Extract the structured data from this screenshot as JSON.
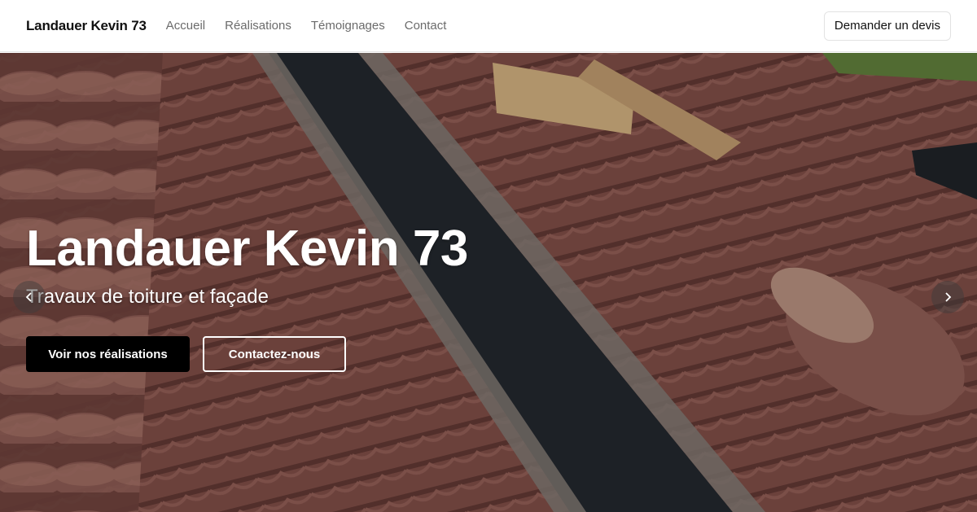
{
  "header": {
    "brand": "Landauer Kevin 73",
    "nav": [
      "Accueil",
      "Réalisations",
      "Témoignages",
      "Contact"
    ],
    "cta": "Demander un devis"
  },
  "hero": {
    "title": "Landauer Kevin 73",
    "subtitle": "Travaux de toiture et façade",
    "primary_button": "Voir nos réalisations",
    "secondary_button": "Contactez-nous",
    "prev_icon": "chevron-left-icon",
    "next_icon": "chevron-right-icon",
    "background_image": "roof tiles photo"
  }
}
